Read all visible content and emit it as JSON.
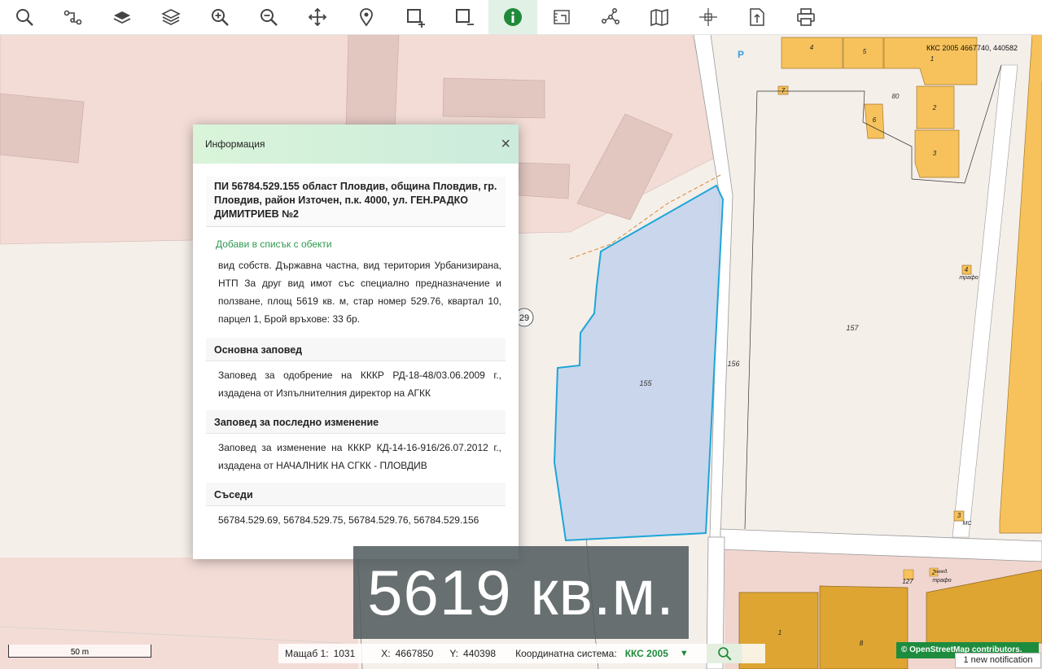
{
  "toolbar": {
    "buttons": [
      {
        "name": "search-icon",
        "active": false
      },
      {
        "name": "route-icon",
        "active": false
      },
      {
        "name": "layer-icon",
        "active": false
      },
      {
        "name": "layers-icon",
        "active": false
      },
      {
        "name": "zoom-in-icon",
        "active": false
      },
      {
        "name": "zoom-out-icon",
        "active": false
      },
      {
        "name": "pan-icon",
        "active": false
      },
      {
        "name": "marker-icon",
        "active": false
      },
      {
        "name": "select-add-icon",
        "active": false
      },
      {
        "name": "select-remove-icon",
        "active": false
      },
      {
        "name": "info-icon",
        "active": true
      },
      {
        "name": "measure-area-icon",
        "active": false
      },
      {
        "name": "measure-distance-icon",
        "active": false
      },
      {
        "name": "map-icon",
        "active": false
      },
      {
        "name": "crosshair-icon",
        "active": false
      },
      {
        "name": "export-icon",
        "active": false
      },
      {
        "name": "print-icon",
        "active": false
      }
    ]
  },
  "map": {
    "coord_label": "ККС 2005 4667740, 440582",
    "parking_label": "P",
    "parcel_labels": [
      "155",
      "156",
      "157"
    ],
    "building_numbers": [
      "4",
      "5",
      "1",
      "2",
      "3",
      "6",
      "7",
      "80",
      "1",
      "8",
      "1",
      "127",
      "2",
      "4",
      "3"
    ],
    "small_labels": [
      "жил.",
      "тр.",
      "тр.",
      "нежд.",
      "МС",
      "трафо",
      "трафо"
    ],
    "circle_label": "29",
    "highlight_color": "#c5d3ec",
    "highlight_border": "#1ea6d8"
  },
  "info": {
    "title": "Информация",
    "close": "×",
    "parcel_title": "ПИ 56784.529.155 област Пловдив, община Пловдив, гр. Пловдив, район Източен, п.к. 4000, ул. ГЕН.РАДКО ДИМИТРИЕВ №2",
    "add_link": "Добави в списък с обекти",
    "description": "вид собств. Държавна частна, вид територия Урбанизирана, НТП За друг вид имот със специално предназначение и ползване, площ 5619 кв. м, стар номер 529.76, квартал 10, парцел 1, Брой връхове: 33 бр.",
    "main_order_head": "Основна заповед",
    "main_order_text": "Заповед за одобрение на КККР РД-18-48/03.06.2009 г., издадена от Изпълнителния директор на АГКК",
    "last_change_head": "Заповед за последно изменение",
    "last_change_text": "Заповед за изменение на КККР КД-14-16-916/26.07.2012 г., издадена от НАЧАЛНИК НА СГКК - ПЛОВДИВ",
    "neighbors_head": "Съседи",
    "neighbors_text": "56784.529.69, 56784.529.75, 56784.529.76, 56784.529.156"
  },
  "area_overlay": "5619 кв.м.",
  "scalebar": "50 m",
  "status": {
    "scale_label": "Мащаб 1:",
    "scale_value": "1031",
    "x_label": "X:",
    "x_value": "4667850",
    "y_label": "Y:",
    "y_value": "440398",
    "coord_sys_label": "Координатна система:",
    "coord_sys_value": "ККС 2005",
    "dropdown_arrow": "▼"
  },
  "osm": "© OpenStreetMap contributors.",
  "notification": "1 new notification"
}
